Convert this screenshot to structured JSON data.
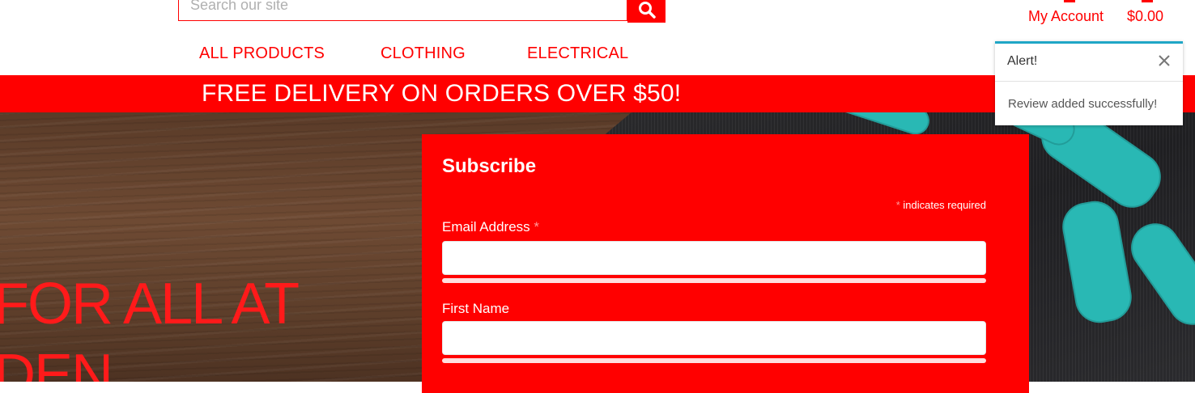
{
  "header": {
    "search": {
      "placeholder": "Search our site",
      "button_icon": "search-icon"
    },
    "account": {
      "label": "My Account",
      "cart_total": "$0.00"
    }
  },
  "nav": {
    "items": [
      {
        "label": "ALL PRODUCTS"
      },
      {
        "label": "CLOTHING"
      },
      {
        "label": "ELECTRICAL"
      }
    ]
  },
  "promo": {
    "text": "FREE DELIVERY ON ORDERS OVER $50!"
  },
  "hero": {
    "title_line1": "FOR ALL AT",
    "title_line2": "DEN"
  },
  "subscribe": {
    "title": "Subscribe",
    "required_asterisk": "*",
    "required_note": "indicates required",
    "fields": [
      {
        "label": "Email Address",
        "required": "*"
      },
      {
        "label": "First Name"
      }
    ]
  },
  "alert": {
    "title": "Alert!",
    "message": "Review added successfully!",
    "close_icon": "close-icon"
  },
  "colors": {
    "brand_red": "#ff0000",
    "alert_accent": "#1fa6c6",
    "ribbon_teal": "#29b8b4"
  }
}
